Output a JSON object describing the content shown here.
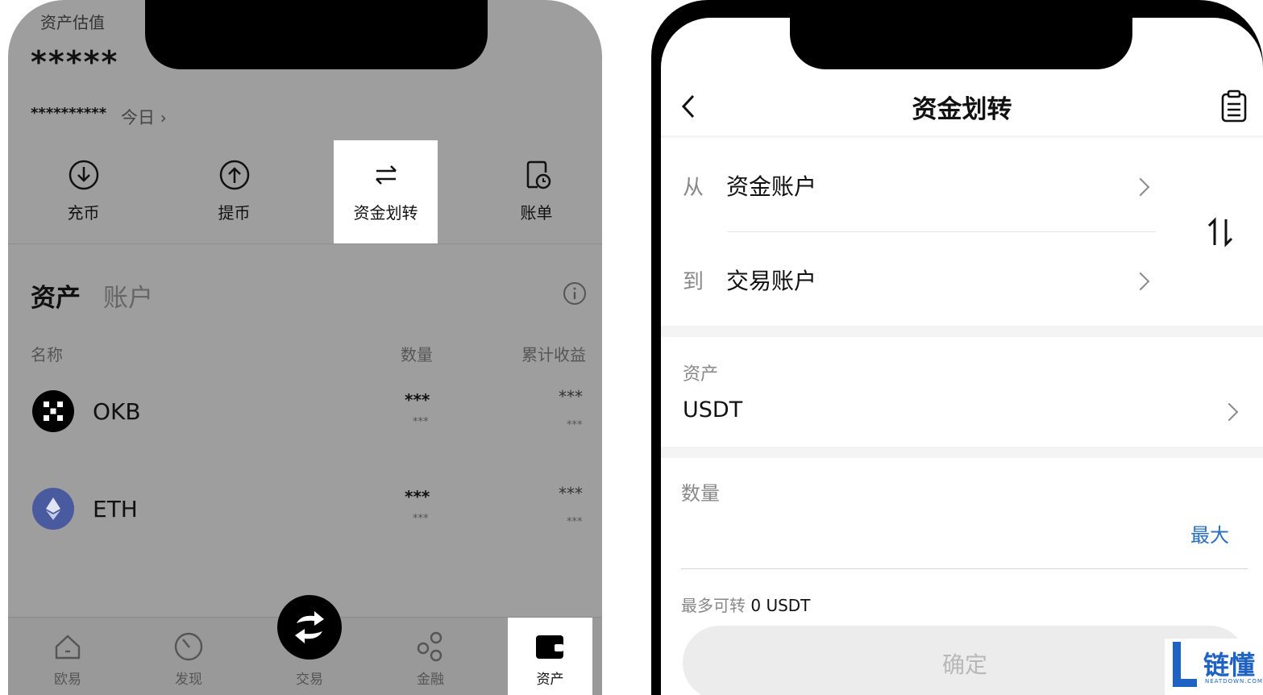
{
  "left": {
    "header_label": "资产估值",
    "masked_balance": "*****",
    "masked_sub": "**********",
    "today_link": "今日",
    "actions": [
      {
        "label": "充币",
        "icon": "deposit-icon"
      },
      {
        "label": "提币",
        "icon": "withdraw-icon"
      },
      {
        "label": "资金划转",
        "icon": "transfer-icon"
      },
      {
        "label": "账单",
        "icon": "bill-icon"
      }
    ],
    "section_tabs": [
      "资产",
      "账户"
    ],
    "columns": [
      "名称",
      "数量",
      "累计收益"
    ],
    "assets": [
      {
        "name": "OKB",
        "qty": "***",
        "qty_sub": "***",
        "pnl": "***",
        "pnl_sub": "***",
        "icon": "okb-logo-icon",
        "color": "#000000"
      },
      {
        "name": "ETH",
        "qty": "***",
        "qty_sub": "***",
        "pnl": "***",
        "pnl_sub": "***",
        "icon": "eth-logo-icon",
        "color": "#4a5a9e"
      }
    ],
    "bottom_nav": [
      {
        "label": "欧易",
        "icon": "home-icon"
      },
      {
        "label": "发现",
        "icon": "discover-icon"
      },
      {
        "label": "交易",
        "icon": "trade-swap-icon"
      },
      {
        "label": "金融",
        "icon": "finance-icon"
      },
      {
        "label": "资产",
        "icon": "wallet-icon"
      }
    ]
  },
  "right": {
    "title": "资金划转",
    "from_label": "从",
    "from_account": "资金账户",
    "to_label": "到",
    "to_account": "交易账户",
    "asset_label": "资产",
    "asset_value": "USDT",
    "amount_label": "数量",
    "max_button": "最大",
    "available_label": "最多可转",
    "available_value": "0 USDT",
    "confirm_button": "确定",
    "accent_color": "#2a6fbd"
  },
  "watermark": {
    "brand": "链懂",
    "domain": "NEATDOWN.COM"
  }
}
